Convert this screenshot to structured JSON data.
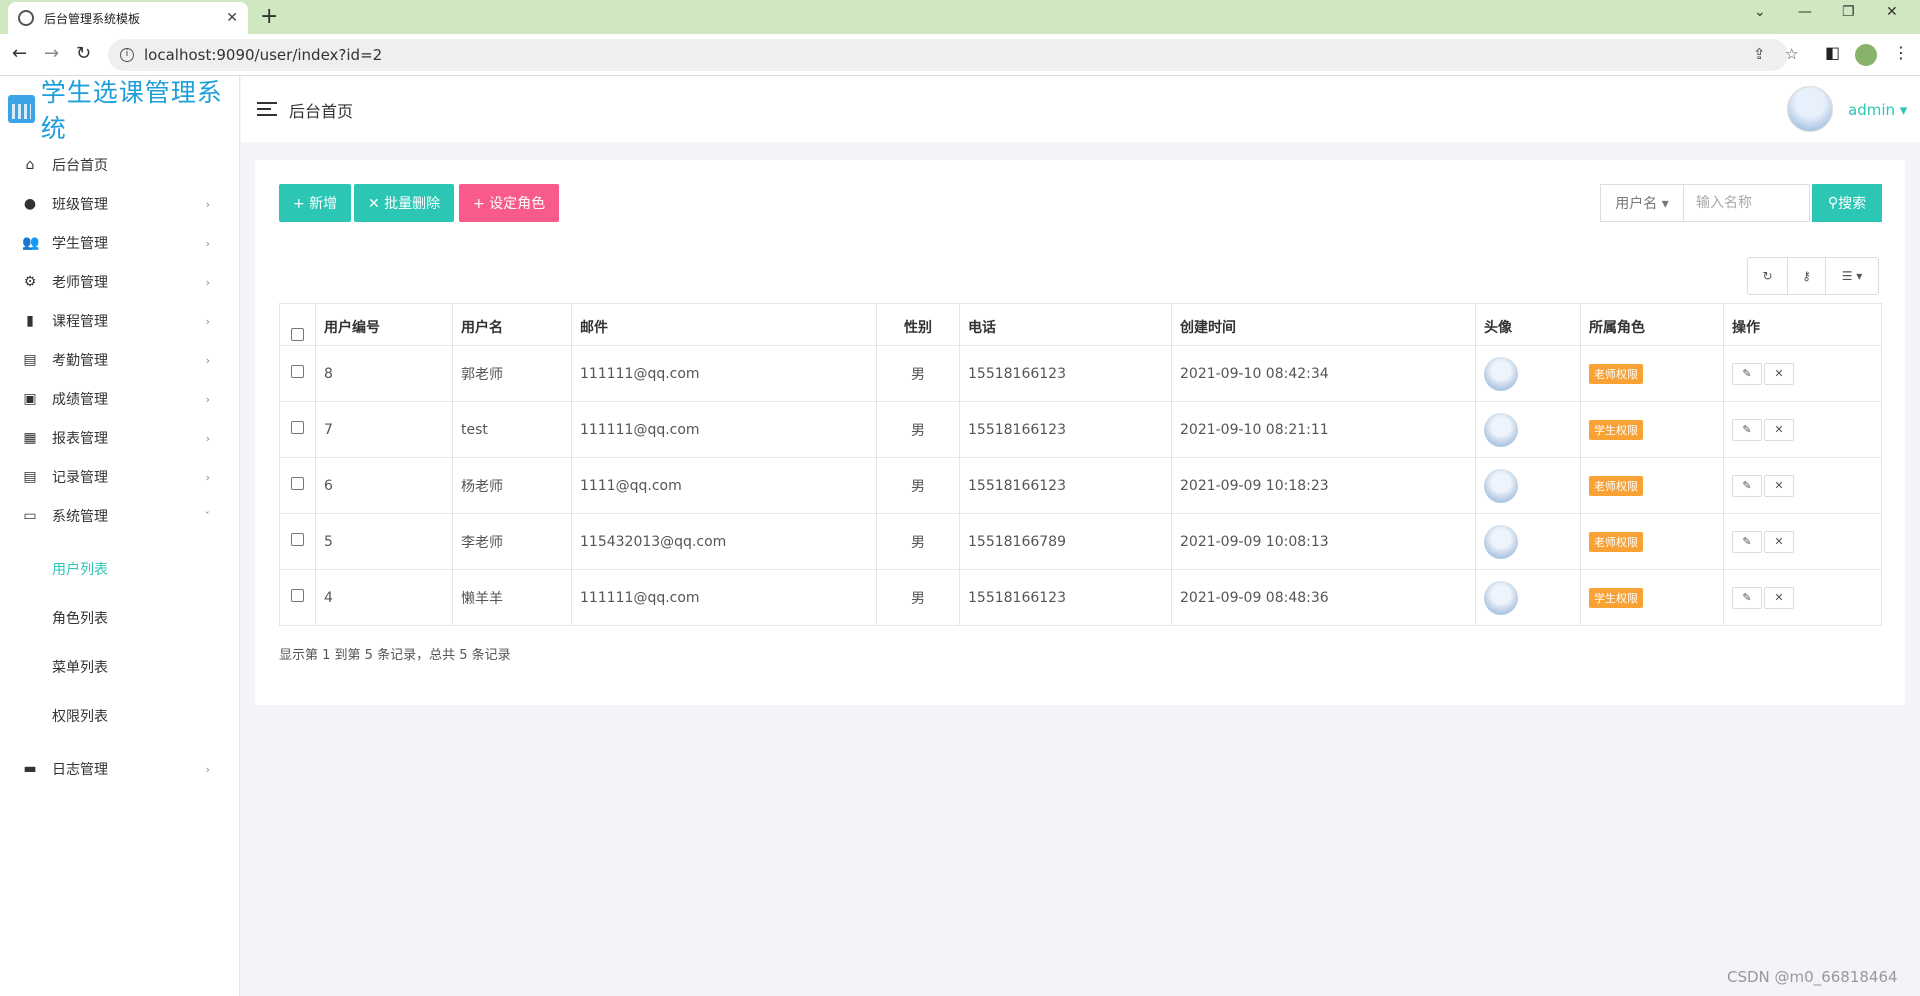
{
  "browser": {
    "tab_title": "后台管理系统模板",
    "url": "localhost:9090/user/index?id=2"
  },
  "sidebar": {
    "brand": "学生选课管理系统",
    "items": [
      {
        "label": "后台首页",
        "icon": "home-icon"
      },
      {
        "label": "班级管理",
        "icon": "palette-icon"
      },
      {
        "label": "学生管理",
        "icon": "people-icon"
      },
      {
        "label": "老师管理",
        "icon": "teacher-icon"
      },
      {
        "label": "课程管理",
        "icon": "file-icon"
      },
      {
        "label": "考勤管理",
        "icon": "doc-icon"
      },
      {
        "label": "成绩管理",
        "icon": "doc-check-icon"
      },
      {
        "label": "报表管理",
        "icon": "report-icon"
      },
      {
        "label": "记录管理",
        "icon": "record-icon"
      },
      {
        "label": "系统管理",
        "icon": "system-icon"
      },
      {
        "label": "日志管理",
        "icon": "log-icon"
      }
    ],
    "system_sub": [
      {
        "label": "用户列表",
        "active": true
      },
      {
        "label": "角色列表"
      },
      {
        "label": "菜单列表"
      },
      {
        "label": "权限列表"
      }
    ]
  },
  "header": {
    "breadcrumb": "后台首页",
    "username": "admin"
  },
  "toolbar": {
    "add": "+ 新增",
    "batch_delete": "✕ 批量删除",
    "set_role": "+ 设定角色",
    "search_field": "用户名 ▾",
    "search_placeholder": "输入名称",
    "search_button": "搜索"
  },
  "table": {
    "headers": [
      "用户编号",
      "用户名",
      "邮件",
      "性别",
      "电话",
      "创建时间",
      "头像",
      "所属角色",
      "操作"
    ],
    "rows": [
      {
        "id": "8",
        "name": "郭老师",
        "email": "111111@qq.com",
        "sex": "男",
        "phone": "15518166123",
        "created": "2021-09-10 08:42:34",
        "role": "老师权限"
      },
      {
        "id": "7",
        "name": "test",
        "email": "111111@qq.com",
        "sex": "男",
        "phone": "15518166123",
        "created": "2021-09-10 08:21:11",
        "role": "学生权限"
      },
      {
        "id": "6",
        "name": "杨老师",
        "email": "1111@qq.com",
        "sex": "男",
        "phone": "15518166123",
        "created": "2021-09-09 10:18:23",
        "role": "老师权限"
      },
      {
        "id": "5",
        "name": "李老师",
        "email": "115432013@qq.com",
        "sex": "男",
        "phone": "15518166789",
        "created": "2021-09-09 10:08:13",
        "role": "老师权限"
      },
      {
        "id": "4",
        "name": "懒羊羊",
        "email": "111111@qq.com",
        "sex": "男",
        "phone": "15518166123",
        "created": "2021-09-09 08:48:36",
        "role": "学生权限"
      }
    ]
  },
  "pagination": {
    "summary": "显示第 1 到第 5 条记录，总共 5 条记录"
  },
  "watermark": "CSDN @m0_66818464",
  "colors": {
    "accent": "#2cc6b5",
    "pink": "#f85b8b",
    "badge": "#f8a134",
    "brand": "#1e9fd8",
    "tabbar": "#cfe8c2"
  }
}
